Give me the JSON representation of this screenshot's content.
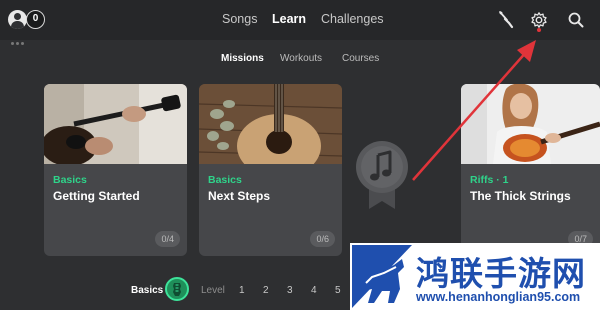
{
  "profile": {
    "notification_count": "0"
  },
  "nav": {
    "songs": "Songs",
    "learn": "Learn",
    "challenges": "Challenges"
  },
  "icons": {
    "tuner": "tuner-icon",
    "settings": "gear-icon",
    "search": "search-icon"
  },
  "subnav": {
    "missions": "Missions",
    "workouts": "Workouts",
    "courses": "Courses"
  },
  "cards": [
    {
      "category": "Basics",
      "title": "Getting Started",
      "progress": "0/4"
    },
    {
      "category": "Basics",
      "title": "Next Steps",
      "progress": "0/6"
    },
    {
      "category": "Riffs · 1",
      "title": "The Thick Strings",
      "progress": "0/7"
    }
  ],
  "level_bar": {
    "current": "Basics",
    "label": "Level",
    "levels": [
      "1",
      "2",
      "3",
      "4",
      "5"
    ]
  },
  "watermark": {
    "title": "鸿联手游网",
    "url": "www.henanhonglian95.com"
  },
  "colors": {
    "accent_green": "#2fd38a",
    "annotation_red": "#e0343a",
    "watermark_blue": "#1f4fae",
    "background": "#2e2f31"
  }
}
